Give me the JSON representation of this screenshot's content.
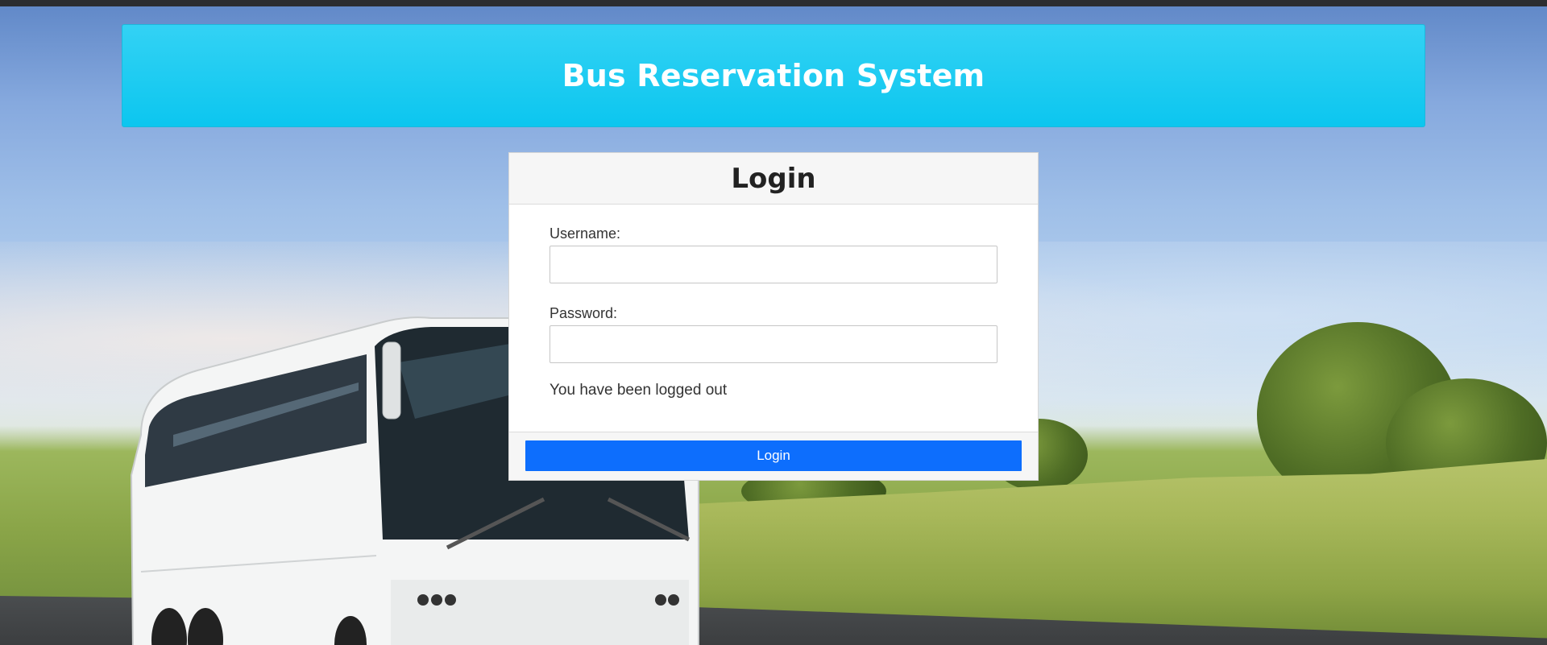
{
  "header": {
    "title": "Bus Reservation System"
  },
  "login_card": {
    "title": "Login",
    "username_label": "Username:",
    "username_value": "",
    "password_label": "Password:",
    "password_value": "",
    "status_message": "You have been logged out",
    "submit_label": "Login"
  },
  "colors": {
    "header_bg": "#17c9f0",
    "button_bg": "#0d6efd",
    "topbar": "#2b2d30"
  },
  "icons": {
    "background": "bus-landscape-photo"
  }
}
